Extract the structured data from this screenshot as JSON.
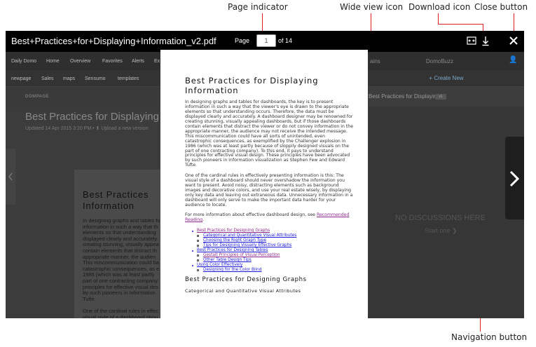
{
  "annotations": {
    "page_indicator": "Page indicator",
    "wide_view_icon": "Wide view icon",
    "download_icon": "Download icon",
    "close_button": "Close button",
    "navigation_button": "Navigation button"
  },
  "viewer": {
    "filename": "Best+Practices+for+Displaying+Information_v2.pdf",
    "page_label": "Page",
    "page_value": "1",
    "of_label": "of 14",
    "icons": [
      "wide-view-icon",
      "download-icon",
      "close-icon",
      "chevron-right-icon"
    ]
  },
  "background_app": {
    "nav_top": [
      "Daily Domo",
      "Home",
      "Overview",
      "Favorites",
      "Alerts",
      "Ex"
    ],
    "nav_sub": [
      "newpage",
      "Sales",
      "maps",
      "Sensumo",
      "templates"
    ],
    "section_label": "DOMPAGE",
    "title": "Best Practices for Displaying Info",
    "subtitle": "Updated 14 Apr 2015 3:20 PM  •  ⬆  Upload a new version",
    "page_heading": "Best Practices\nInformation",
    "page_text": "In designing graphs and tables fo\ninformation in such a way that th\nelements so that understanding\ndisplayed clearly and accurately.\ncreating stunning, visually appea\ncontain elements that distract th\nappropriate manner, the audien\nThis miscommunication could ha\ncatastrophic consequences, as e\n1986 (which was at least partly\npart of one contracting company\nprinciples for effective visual des\nby such pioneers in information\nTufte.\n\nOne of the cardinal rules in effec\nvisual style of a dashboard shou\nwant to present. Avoid noisy, dis\nimages and decorative colors, a\nonly key data and leaving out ex\ndashboard will only serve to ma",
    "right_nav": [
      "ains",
      "DomoBuzz"
    ],
    "create_new": "+ Create New",
    "discussion_title": "Best Practices for Displaying ...",
    "discussion_badge": "v1",
    "no_discussions": "NO DISCUSSIONS HERE",
    "start_one": "Start one ❯"
  },
  "document": {
    "title": "Best Practices for Displaying\nInformation",
    "para1": "In designing graphs and tables for dashboards, the key is to present\ninformation in such a way that the viewer's eye is drawn to the appropriate\nelements so that understanding occurs. Therefore, the data must be\ndisplayed clearly and accurately. A dashboard designer may be renowned for\ncreating stunning, visually appealing dashboards, but if those dashboards\ncontain elements that distract the viewer or do not convey information in the\nappropriate manner, the audience may not receive the intended message.\nThis miscommunication could have all sorts of unintended, even\ncatastrophic consequences, as exemplified by the Challenger explosion in\n1986 (which was at least partly because of sloppily designed visuals on the\npart of one contracting company). To this end, it pays to understand\nprinciples for effective visual design. These principles have been advocated\nby such pioneers in information visualization as Stephen Few and Edward\nTufte.",
    "para2": "One of the cardinal rules in effectively presenting information is this: The\nvisual style of a dashboard should never overshadow the information you\nwant to present. Avoid noisy, distracting elements such as background\nimages and decorative colors, and use your real estate wisely, by displaying\nonly key data and leaving out extraneous data. Unnecessary information in a\ndashboard will only serve to make the important data harder for your\naudience to locate.",
    "para3_prefix": "For more information about effective dashboard design, see ",
    "para3_link_1": "Recommended",
    "para3_link_2": "Reading",
    "para3_suffix": ".",
    "toc": [
      {
        "level": 1,
        "label": "Best Practices for Designing Graphs",
        "visited": true
      },
      {
        "level": 2,
        "label": "Categorical and Quantitative Visual Attributes",
        "visited": false
      },
      {
        "level": 2,
        "label": "Choosing the Right Graph Type",
        "visited": false
      },
      {
        "level": 2,
        "label": "Tips for Designing Visually Effective Graphs",
        "visited": false
      },
      {
        "level": 1,
        "label": "Best Practices for Designing Tables",
        "visited": false
      },
      {
        "level": 2,
        "label": "Gestalt Principles of Visual Perception",
        "visited": true
      },
      {
        "level": 2,
        "label": "Other Table Design Tips",
        "visited": false
      },
      {
        "level": 1,
        "label": "Using Color Effectively",
        "visited": false
      },
      {
        "level": 2,
        "label": "Designing for the Color Blind",
        "visited": false
      }
    ],
    "section_heading": "Best Practices for Designing Graphs",
    "subsection_heading": "Categorical and Quantitative Visual Attributes"
  }
}
